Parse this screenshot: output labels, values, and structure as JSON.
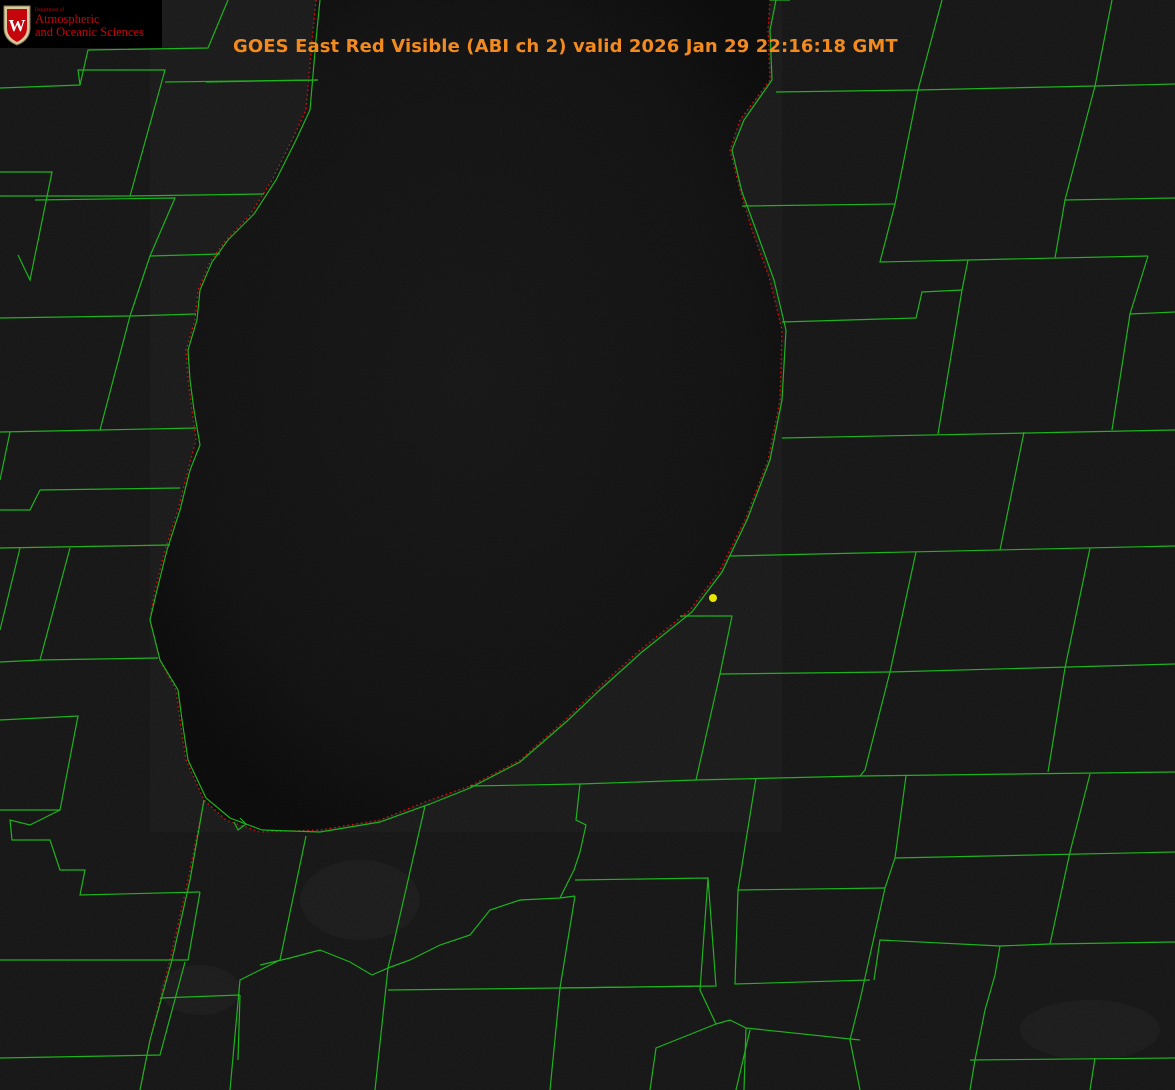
{
  "logo": {
    "department_label": "Department of",
    "line1": "Atmospheric",
    "line2": "and Oceanic Sciences",
    "crest_letter": "W",
    "text_color": "#c5050c",
    "crest_color": "#c5050c"
  },
  "title": {
    "text": "GOES East Red Visible (ABI ch 2) valid 2026 Jan 29 22:16:18 GMT",
    "color": "#f28a1e"
  },
  "map": {
    "background_color": "#141414",
    "lake_color": "#0c0c0c",
    "boundary_color": "#1db31d",
    "shoreline_color": "#e01010",
    "marker_color": "#e6e600",
    "features": [
      "county-boundaries",
      "lake-shoreline",
      "point-marker"
    ]
  }
}
